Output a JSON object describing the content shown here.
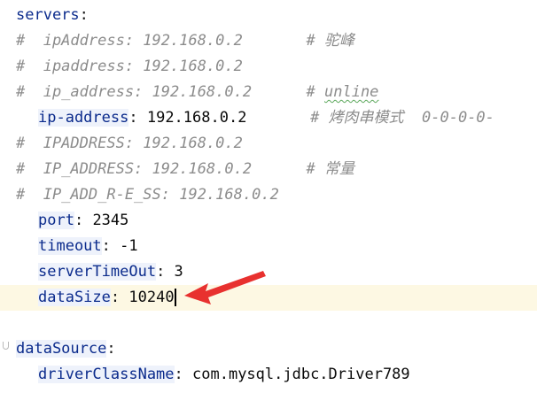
{
  "editor": {
    "lines": [
      {
        "indent": false,
        "parts": [
          {
            "cls": "key-plain",
            "t": "servers"
          },
          {
            "cls": "colon",
            "t": ":"
          }
        ]
      },
      {
        "indent": false,
        "parts": [
          {
            "cls": "comment",
            "t": "#  ipAddress: 192.168.0.2       # "
          },
          {
            "cls": "comment",
            "t": "驼峰"
          }
        ]
      },
      {
        "indent": false,
        "parts": [
          {
            "cls": "comment",
            "t": "#  ipaddress: 192.168.0.2"
          }
        ]
      },
      {
        "indent": false,
        "parts": [
          {
            "cls": "comment",
            "t": "#  ip_address: 192.168.0.2      # "
          },
          {
            "cls": "comment squiggle",
            "t": "unline"
          }
        ]
      },
      {
        "indent": true,
        "parts": [
          {
            "cls": "key",
            "t": "ip-address"
          },
          {
            "cls": "colon",
            "t": ": "
          },
          {
            "cls": "val",
            "t": "192.168.0.2"
          },
          {
            "cls": "comment",
            "t": "       # 烤肉串模式  0-0-0-0-"
          }
        ]
      },
      {
        "indent": false,
        "parts": [
          {
            "cls": "comment",
            "t": "#  IPADDRESS: 192.168.0.2"
          }
        ]
      },
      {
        "indent": false,
        "parts": [
          {
            "cls": "comment",
            "t": "#  IP_ADDRESS: 192.168.0.2      # "
          },
          {
            "cls": "comment",
            "t": "常量"
          }
        ]
      },
      {
        "indent": false,
        "parts": [
          {
            "cls": "comment",
            "t": "#  IP_ADD_R-E_SS: 192.168.0.2"
          }
        ]
      },
      {
        "indent": true,
        "parts": [
          {
            "cls": "key",
            "t": "port"
          },
          {
            "cls": "colon",
            "t": ": "
          },
          {
            "cls": "val",
            "t": "2345"
          }
        ]
      },
      {
        "indent": true,
        "parts": [
          {
            "cls": "key",
            "t": "timeout"
          },
          {
            "cls": "colon",
            "t": ": "
          },
          {
            "cls": "val",
            "t": "-1"
          }
        ]
      },
      {
        "indent": true,
        "parts": [
          {
            "cls": "key",
            "t": "serverTimeOut"
          },
          {
            "cls": "colon",
            "t": ": "
          },
          {
            "cls": "val",
            "t": "3"
          }
        ]
      },
      {
        "indent": true,
        "current": true,
        "caret": true,
        "parts": [
          {
            "cls": "key",
            "t": "dataSize"
          },
          {
            "cls": "colon",
            "t": ": "
          },
          {
            "cls": "val",
            "t": "10240"
          }
        ]
      },
      {
        "indent": false,
        "parts": []
      },
      {
        "indent": false,
        "parts": [
          {
            "cls": "key",
            "t": "dataSource"
          },
          {
            "cls": "colon",
            "t": ":"
          }
        ]
      },
      {
        "indent": true,
        "parts": [
          {
            "cls": "key",
            "t": "driverClassName"
          },
          {
            "cls": "colon",
            "t": ": "
          },
          {
            "cls": "val",
            "t": "com.mysql.jdbc.Driver789"
          }
        ]
      }
    ]
  },
  "colors": {
    "key": "#0b2b8c",
    "comment": "#8c8c8c",
    "current_line": "#fdf8e3",
    "arrow": "#e8312f",
    "squiggle": "#5ca85c"
  },
  "icons": [
    "fold-marker-icon",
    "annotation-arrow-icon",
    "text-caret-icon"
  ]
}
